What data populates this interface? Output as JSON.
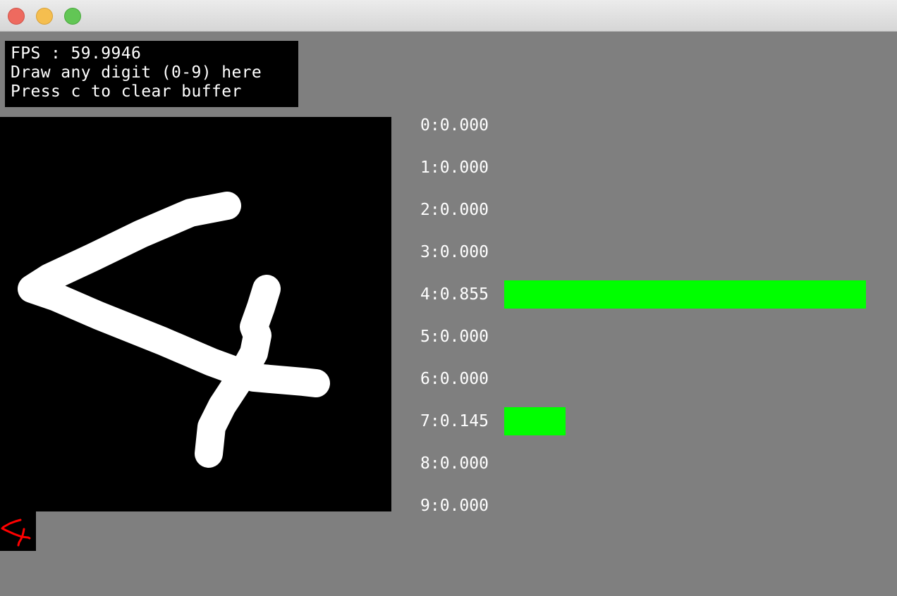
{
  "info": {
    "fps_line": "FPS : 59.9946",
    "instruction_line": "Draw any digit (0-9) here",
    "clear_line": "Press c to clear buffer"
  },
  "probabilities": [
    {
      "digit": "0",
      "label": "0:0.000",
      "value": 0.0
    },
    {
      "digit": "1",
      "label": "1:0.000",
      "value": 0.0
    },
    {
      "digit": "2",
      "label": "2:0.000",
      "value": 0.0
    },
    {
      "digit": "3",
      "label": "3:0.000",
      "value": 0.0
    },
    {
      "digit": "4",
      "label": "4:0.855",
      "value": 0.855
    },
    {
      "digit": "5",
      "label": "5:0.000",
      "value": 0.0
    },
    {
      "digit": "6",
      "label": "6:0.000",
      "value": 0.0
    },
    {
      "digit": "7",
      "label": "7:0.145",
      "value": 0.145
    },
    {
      "digit": "8",
      "label": "8:0.000",
      "value": 0.0
    },
    {
      "digit": "9",
      "label": "9:0.000",
      "value": 0.0
    }
  ],
  "colors": {
    "background": "#7f7f7f",
    "bar": "#00ff00",
    "stroke": "#ffffff",
    "preview_stroke": "#ff0000"
  }
}
